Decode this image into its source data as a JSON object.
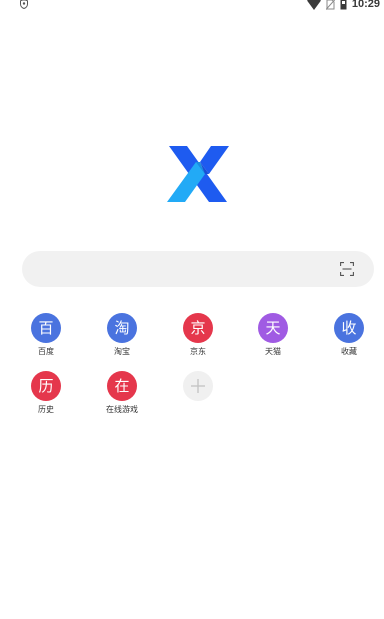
{
  "status_bar": {
    "time": "10:29",
    "icons": [
      "shield-icon",
      "wifi-icon",
      "no-sim-icon",
      "battery-icon"
    ]
  },
  "logo": {
    "name": "x-browser-logo",
    "colors": [
      "#1e5bf0",
      "#22aaf6"
    ]
  },
  "search": {
    "value": "",
    "placeholder": "",
    "scan_icon": "scan-icon"
  },
  "shortcuts": [
    {
      "glyph": "百",
      "label": "百度",
      "color": "#4a73df"
    },
    {
      "glyph": "淘",
      "label": "淘宝",
      "color": "#4a73df"
    },
    {
      "glyph": "京",
      "label": "京东",
      "color": "#e5374c"
    },
    {
      "glyph": "天",
      "label": "天猫",
      "color": "#a05be3"
    },
    {
      "glyph": "收",
      "label": "收藏",
      "color": "#4a73df"
    },
    {
      "glyph": "历",
      "label": "历史",
      "color": "#e5374c"
    },
    {
      "glyph": "在",
      "label": "在线游戏",
      "color": "#e5374c"
    }
  ],
  "add_shortcut": {
    "icon": "plus-icon",
    "color": "#f0f0f0"
  }
}
